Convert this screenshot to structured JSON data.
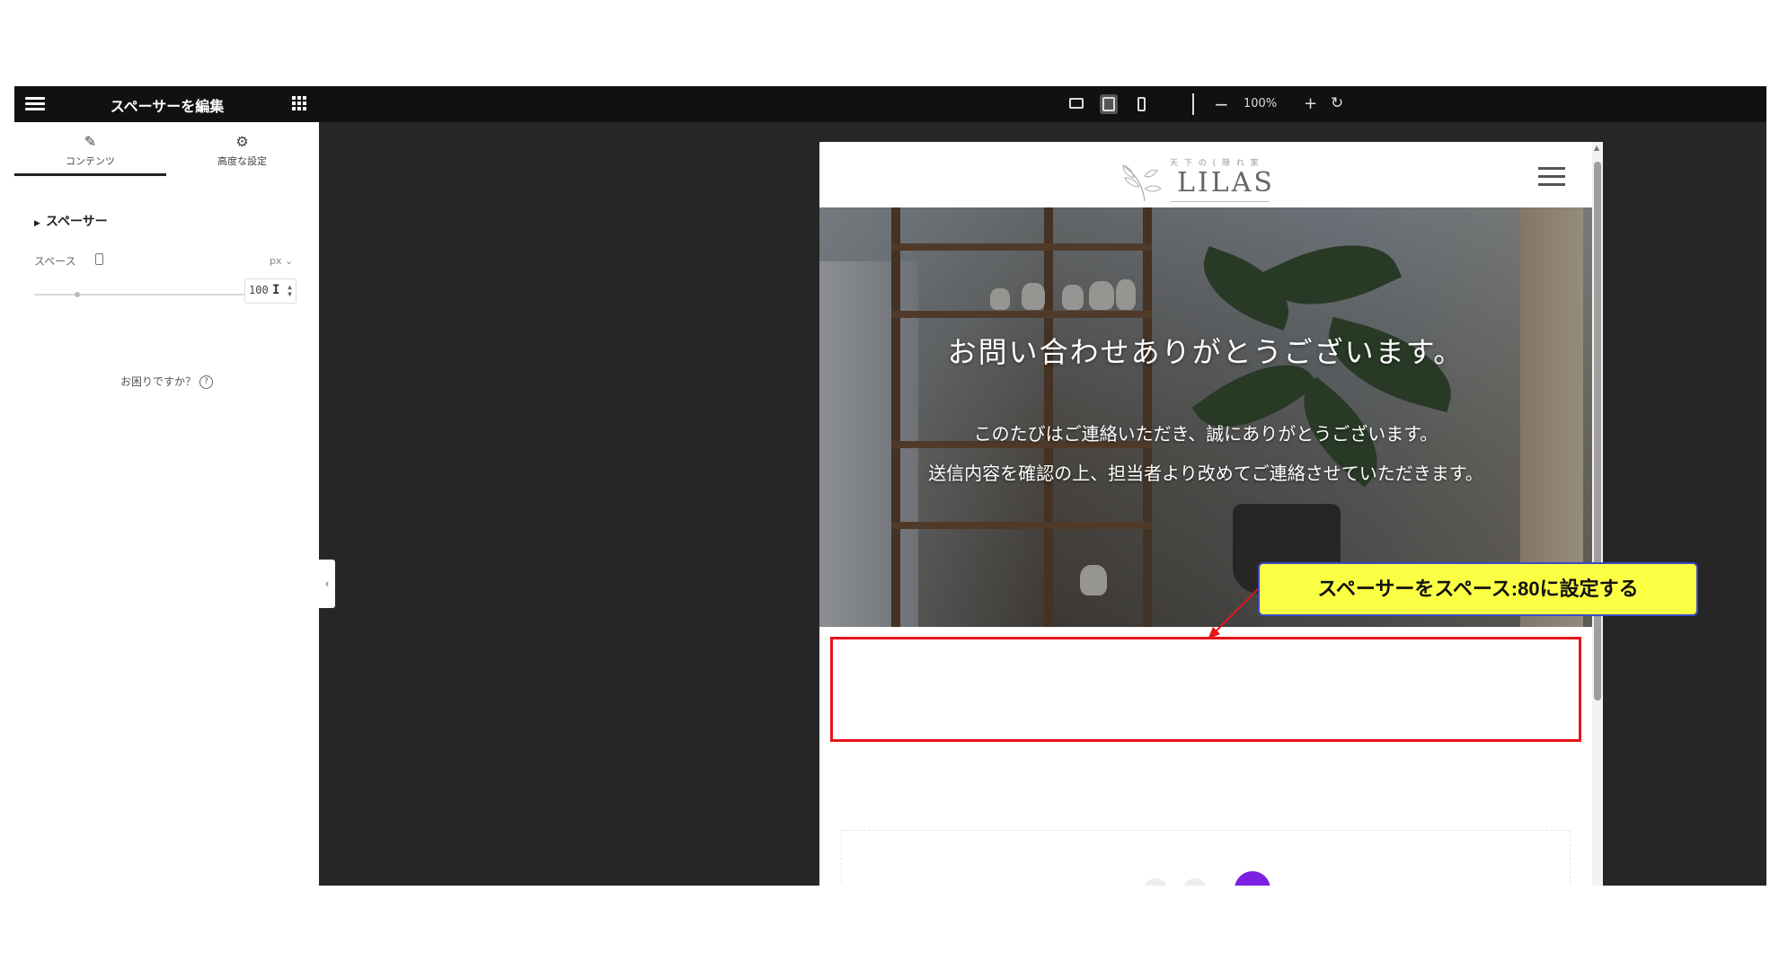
{
  "panel": {
    "title": "スペーサーを編集",
    "tabs": [
      {
        "label": "コンテンツ",
        "icon": "pencil-icon"
      },
      {
        "label": "高度な設定",
        "icon": "gear-icon"
      }
    ],
    "section_title": "スペーサー",
    "space_label": "スペース",
    "unit": "px ⌄",
    "space_value": "100",
    "help_text": "お困りですか？",
    "help_mark": "?"
  },
  "toolbar": {
    "zoom": "100%",
    "minus": "−",
    "plus": "+",
    "reset": "↻"
  },
  "preview": {
    "logo_tag": "天 下 の ( 隠 れ 家",
    "logo_name": "LILAS",
    "hero_title": "お問い合わせありがとうございます。",
    "hero_line1": "このたびはご連絡いただき、誠にありがとうございます。",
    "hero_line2": "送信内容を確認の上、担当者より改めてご連絡させていただきます。"
  },
  "annotation": {
    "callout_text": "スペーサーをスペース:80に設定する",
    "callout_bg": "#fbff43",
    "highlight_color": "#e8141a"
  }
}
